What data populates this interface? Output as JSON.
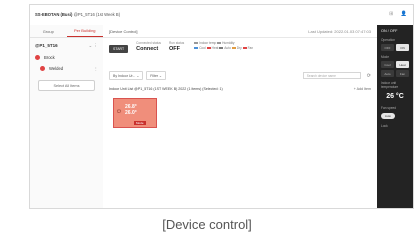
{
  "topbar": {
    "crumb_prefix": "SS-EBOTAN (Busi)",
    "crumb_rest": "@P1_5T16 (1st Week B)"
  },
  "left": {
    "tabs": [
      "Group",
      "Per Building"
    ],
    "group_name": "@P1_5T16",
    "items": [
      {
        "label": "Brock"
      },
      {
        "label": "Welded"
      }
    ],
    "select_all": "Select All Items"
  },
  "main": {
    "title": "[Device Control]",
    "updated": "Last Updated: 2022.01.03 07:47:03",
    "operation_badge": "START",
    "stats": [
      {
        "label": "Connected status",
        "value": "Connect"
      },
      {
        "label": "Run status",
        "value": "OFF"
      }
    ],
    "legend": [
      "Indoor temp",
      "Humidity",
      "Cool",
      "Heat",
      "Auto",
      "Dry",
      "Fan"
    ],
    "filters": [
      "By Indoor Ur...",
      "Filter"
    ],
    "search_placeholder": "Search device name",
    "section_title": "Indoor Unit List @P1_5T16 (1ST WEEK B) 2022 (1 items) (Selected: 1)",
    "add_label": "+ Add Item",
    "card": {
      "temp_set": "26.8°",
      "temp_room": "26.0°",
      "tag": "Mode"
    }
  },
  "right": {
    "title": "ON / OFF",
    "run_label": "Operation",
    "mode_label": "Mode",
    "modes": [
      "Cool",
      "Heat",
      "Auto",
      "Fan"
    ],
    "setpoint_label": "Indoor unit temperature",
    "setpoint": "26 °C",
    "fan_label": "Fan speed",
    "fan_value": "Auto",
    "lock_label": "Lock"
  },
  "caption": "[Device control]"
}
